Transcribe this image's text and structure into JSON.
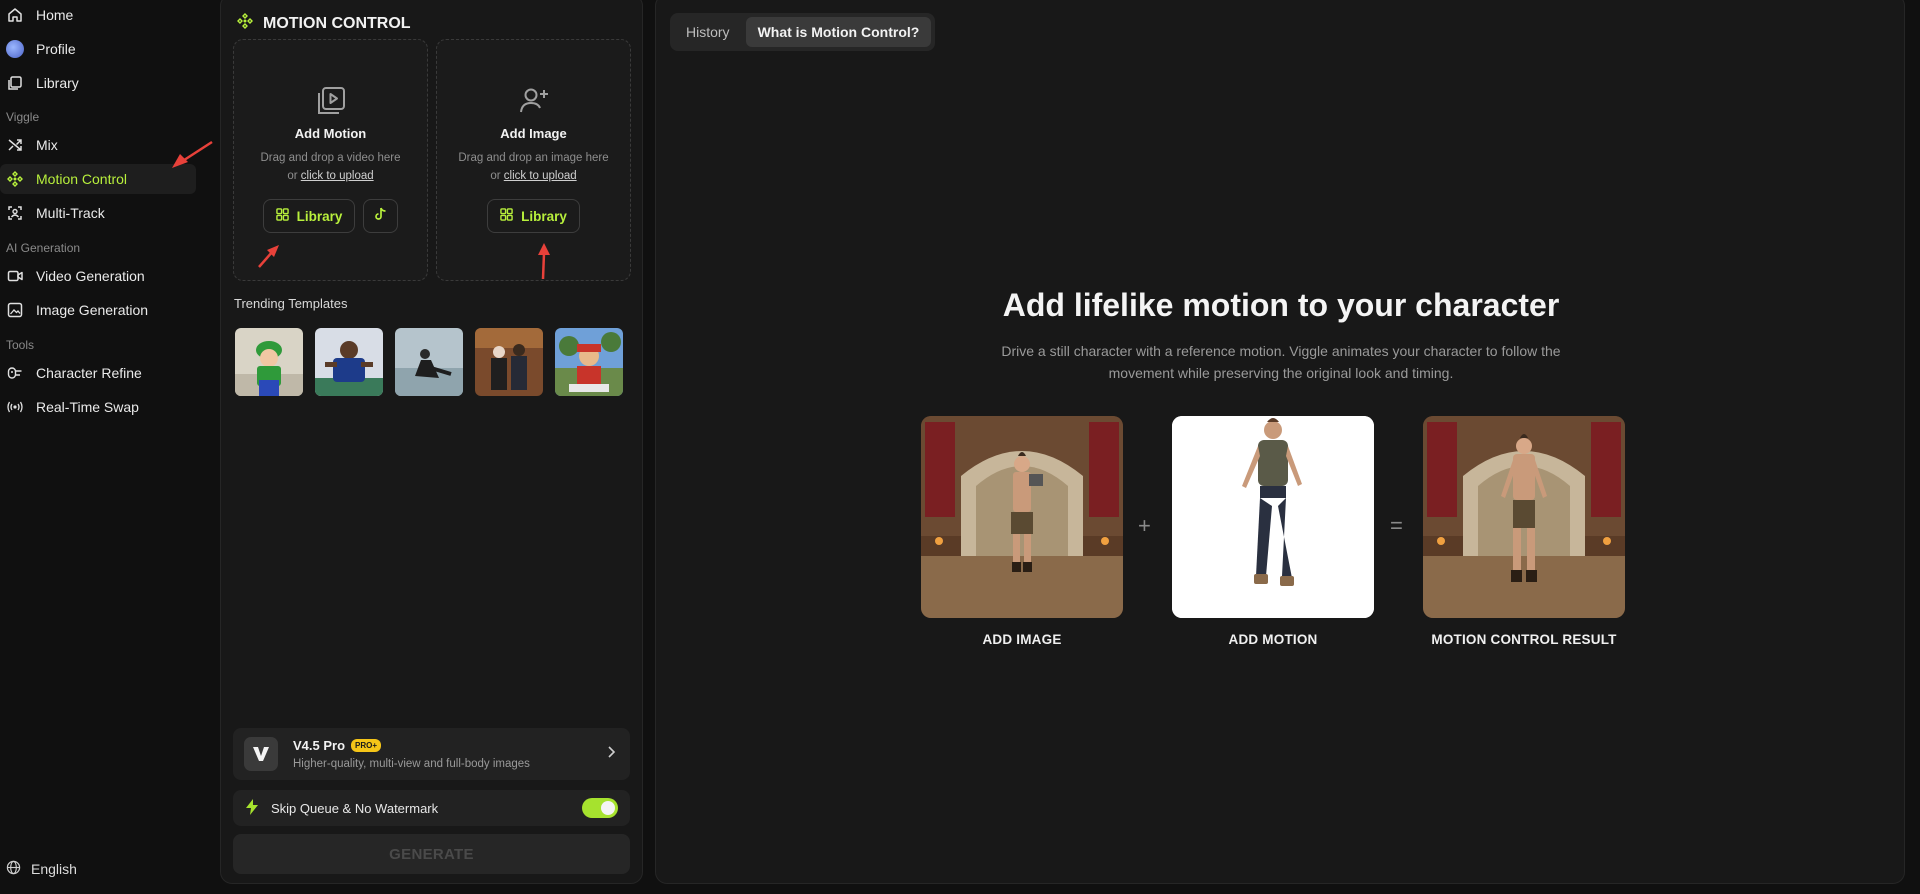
{
  "sidebar": {
    "top_items": [
      {
        "label": "Home",
        "icon": "home-icon"
      },
      {
        "label": "Profile",
        "icon": "avatar"
      },
      {
        "label": "Library",
        "icon": "library-icon"
      }
    ],
    "sections": [
      {
        "title": "Viggle",
        "items": [
          {
            "label": "Mix",
            "icon": "shuffle-icon"
          },
          {
            "label": "Motion Control",
            "icon": "motion-control-icon",
            "active": true
          }
        ]
      },
      {
        "title": "AI Generation",
        "items": [
          {
            "label": "Video Generation",
            "icon": "video-icon"
          },
          {
            "label": "Image Generation",
            "icon": "image-icon"
          },
          {
            "label": "Multi-Track",
            "icon": "multitrack-icon"
          }
        ]
      },
      {
        "title": "Tools",
        "items": [
          {
            "label": "Character Refine",
            "icon": "character-refine-icon"
          },
          {
            "label": "Real-Time Swap",
            "icon": "broadcast-icon"
          }
        ]
      }
    ],
    "language": "English",
    "accent_color": "#b8f03c"
  },
  "panel": {
    "title": "MOTION CONTROL",
    "add_motion": {
      "title": "Add Motion",
      "desc_prefix": "Drag and drop a video here or ",
      "desc_link": "click to upload",
      "library_label": "Library"
    },
    "add_image": {
      "title": "Add Image",
      "desc_prefix": "Drag and drop an image here or ",
      "desc_link": "click to upload",
      "library_label": "Library"
    },
    "trending_label": "Trending Templates",
    "pro": {
      "title": "V4.5 Pro",
      "badge": "PRO+",
      "subtitle": "Higher-quality, multi-view and full-body images"
    },
    "skip_label": "Skip Queue & No Watermark",
    "skip_enabled": true,
    "generate_label": "GENERATE"
  },
  "main": {
    "tabs": [
      {
        "label": "History",
        "active": false
      },
      {
        "label": "What is Motion Control?",
        "active": true
      }
    ],
    "hero_title": "Add lifelike motion to your character",
    "hero_desc": "Drive a still character with a reference motion. Viggle animates your character to follow the movement while preserving the original look and timing.",
    "plus": "+",
    "equals": "=",
    "cards": [
      {
        "label": "ADD IMAGE"
      },
      {
        "label": "ADD MOTION"
      },
      {
        "label": "MOTION CONTROL RESULT"
      }
    ]
  }
}
